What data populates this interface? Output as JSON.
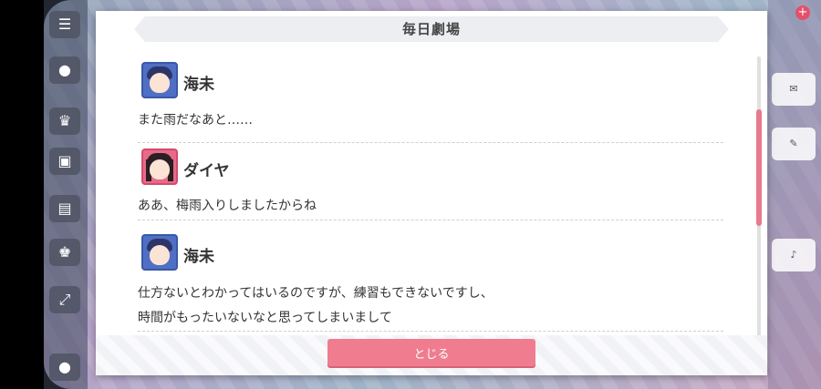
{
  "dialog": {
    "title": "毎日劇場",
    "close_label": "とじる"
  },
  "entries": [
    {
      "speaker": "海未",
      "avatar_icon": "umi-portrait-icon",
      "lines": [
        "また雨だなあと……"
      ]
    },
    {
      "speaker": "ダイヤ",
      "avatar_icon": "dia-portrait-icon",
      "lines": [
        "ああ、梅雨入りしましたからね"
      ]
    },
    {
      "speaker": "海未",
      "avatar_icon": "umi-portrait-icon",
      "lines": [
        "仕方ないとわかってはいるのですが、練習もできないですし、",
        "時間がもったいないなと思ってしまいまして"
      ]
    }
  ],
  "colors": {
    "accent": "#ef7d8f",
    "scrollbar": "#e8798e",
    "umi_frame": "#4f6fc4",
    "dia_frame": "#e86a88"
  }
}
